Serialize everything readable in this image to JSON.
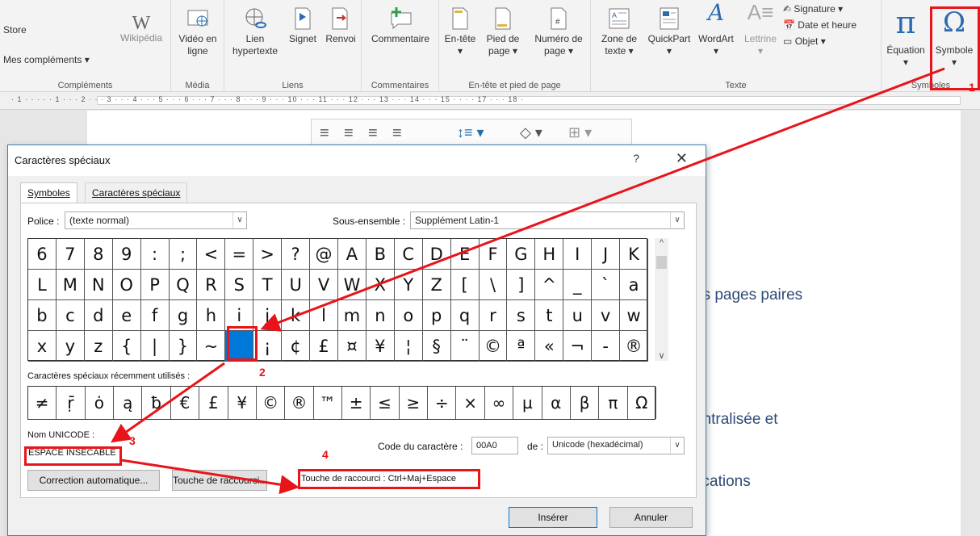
{
  "ribbon": {
    "groups": [
      {
        "label": "Compléments",
        "store": "Store",
        "my_addins": "Mes compléments",
        "wikipedia": "Wikipédia"
      },
      {
        "label": "Média",
        "video": "Vidéo en ligne"
      },
      {
        "label": "Liens",
        "link": "Lien hypertexte",
        "bookmark": "Signet",
        "xref": "Renvoi"
      },
      {
        "label": "Commentaires",
        "comment": "Commentaire"
      },
      {
        "label": "En-tête et pied de page",
        "header": "En-tête",
        "footer": "Pied de page",
        "pagenum": "Numéro de page"
      },
      {
        "label": "Texte",
        "textbox": "Zone de texte",
        "quickpart": "QuickPart",
        "wordart": "WordArt",
        "dropcap": "Lettrine",
        "signature": "Signature",
        "datetime": "Date et heure",
        "object": "Objet"
      },
      {
        "label": "Symboles",
        "equation": "Équation",
        "symbol": "Symbole"
      }
    ]
  },
  "ruler": {
    "ticks": "· 1 · ·   · · · 1 · · · 2 · · · 3 · · · 4 · · · 5 · · · 6 · · · 7 · · · 8 · · · 9 · · · 10 · · · 11 · · · 12 · · · 13 · · · 14 · · · 15 · · ·       · 17 · · · 18 ·"
  },
  "document": {
    "lines": [
      "es pages paires",
      "entralisée et",
      "fications"
    ]
  },
  "dialog": {
    "title": "Caractères spéciaux",
    "help": "?",
    "close": "✕",
    "tabs": [
      "Symboles",
      "Caractères spéciaux"
    ],
    "font_label": "Police :",
    "font_value": "(texte normal)",
    "subset_label": "Sous-ensemble :",
    "subset_value": "Supplément Latin-1",
    "grid": [
      [
        "6",
        "7",
        "8",
        "9",
        ":",
        ";",
        "<",
        "=",
        ">",
        "?",
        "@",
        "A",
        "B",
        "C",
        "D",
        "E",
        "F",
        "G",
        "H",
        "I",
        "J",
        "K"
      ],
      [
        "L",
        "M",
        "N",
        "O",
        "P",
        "Q",
        "R",
        "S",
        "T",
        "U",
        "V",
        "W",
        "X",
        "Y",
        "Z",
        "[",
        "\\",
        "]",
        "^",
        "_",
        "`",
        "a"
      ],
      [
        "b",
        "c",
        "d",
        "e",
        "f",
        "g",
        "h",
        "i",
        "j",
        "k",
        "l",
        "m",
        "n",
        "o",
        "p",
        "q",
        "r",
        "s",
        "t",
        "u",
        "v",
        "w"
      ],
      [
        "x",
        "y",
        "z",
        "{",
        "|",
        "}",
        "~",
        " ",
        "¡",
        "¢",
        "£",
        "¤",
        "¥",
        "¦",
        "§",
        "¨",
        "©",
        "ª",
        "«",
        "¬",
        "-",
        "®"
      ]
    ],
    "selected_cell": {
      "row": 3,
      "col": 7
    },
    "recent_label": "Caractères spéciaux récemment utilisés :",
    "recent": [
      "≠",
      "ṝ",
      "ȯ",
      "ą",
      "ƀ",
      "€",
      "£",
      "¥",
      "©",
      "®",
      "™",
      "±",
      "≤",
      "≥",
      "÷",
      "×",
      "∞",
      "µ",
      "α",
      "β",
      "π",
      "Ω"
    ],
    "unicode_name_label": "Nom UNICODE :",
    "unicode_name": "ESPACE INSÉCABLE",
    "char_code_label": "Code du caractère :",
    "char_code": "00A0",
    "from_label": "de :",
    "from_value": "Unicode (hexadécimal)",
    "autocorrect": "Correction automatique...",
    "shortcut_btn": "Touche de raccourci...",
    "shortcut_text": "Touche de raccourci : Ctrl+Maj+Espace",
    "insert": "Insérer",
    "cancel": "Annuler"
  },
  "annotations": [
    "1",
    "2",
    "3",
    "4"
  ],
  "colors": {
    "annotation": "#e8141a",
    "selection": "#0078d7",
    "doc_text": "#2f4a79"
  }
}
